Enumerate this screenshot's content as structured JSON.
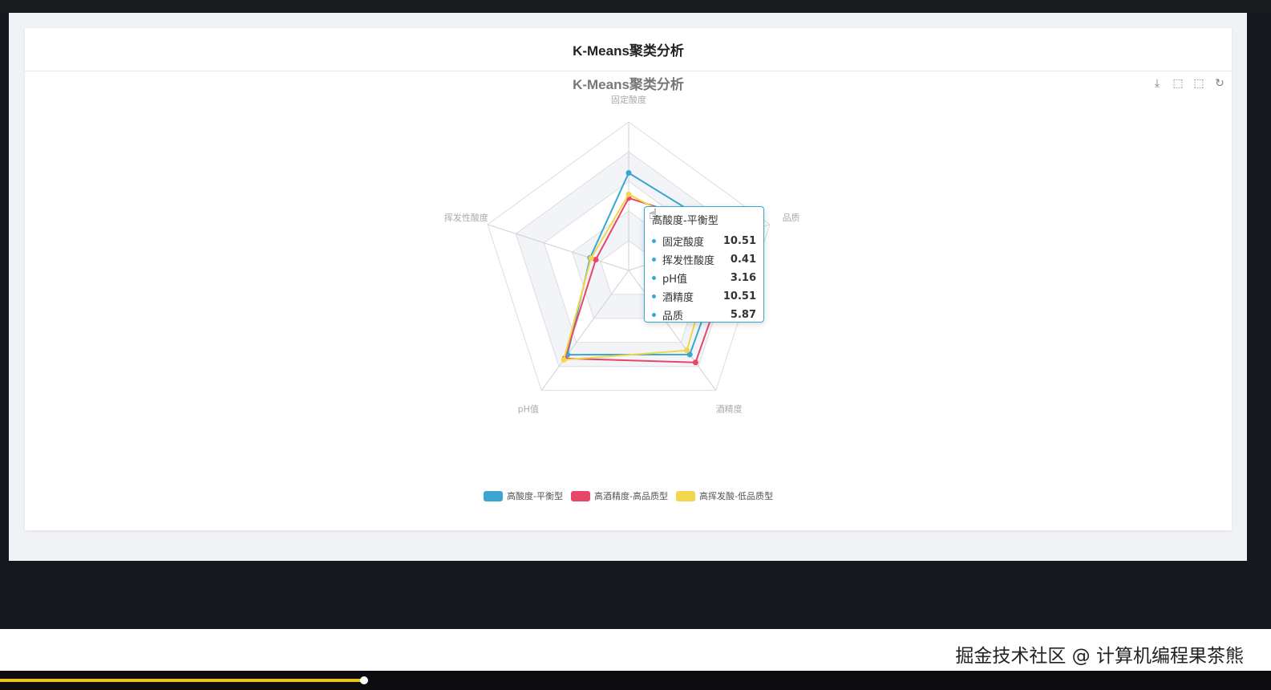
{
  "card": {
    "header_title": "K-Means聚类分析"
  },
  "chart_data": {
    "type": "radar",
    "title": "K-Means聚类分析",
    "indicators": [
      {
        "name": "固定酸度",
        "max": 16
      },
      {
        "name": "品质",
        "max": 8
      },
      {
        "name": "酒精度",
        "max": 15
      },
      {
        "name": "pH值",
        "max": 4.5
      },
      {
        "name": "挥发性酸度",
        "max": 1.5
      }
    ],
    "series": [
      {
        "name": "高酸度-平衡型",
        "color": "#3ba7d0",
        "values": [
          10.51,
          5.87,
          10.51,
          3.16,
          0.41
        ]
      },
      {
        "name": "高酒精度-高品质型",
        "color": "#e8456a",
        "values": [
          7.8,
          6.35,
          11.5,
          3.3,
          0.35
        ]
      },
      {
        "name": "高挥发酸-低品质型",
        "color": "#f2d64b",
        "values": [
          8.2,
          5.1,
          10.0,
          3.35,
          0.4
        ]
      }
    ],
    "split_number": 5,
    "legend_position": "bottom"
  },
  "tooltip": {
    "title": "高酸度-平衡型",
    "rows": [
      {
        "label": "固定酸度",
        "value": "10.51"
      },
      {
        "label": "挥发性酸度",
        "value": "0.41"
      },
      {
        "label": "pH值",
        "value": "3.16"
      },
      {
        "label": "酒精度",
        "value": "10.51"
      },
      {
        "label": "品质",
        "value": "5.87"
      }
    ],
    "color": "#3ba7d0"
  },
  "toolbox": [
    {
      "icon": "download-icon",
      "glyph": "⤓"
    },
    {
      "icon": "data-zoom-icon",
      "glyph": "⬚"
    },
    {
      "icon": "zoom-reset-icon",
      "glyph": "⬚"
    },
    {
      "icon": "restore-icon",
      "glyph": "↻"
    }
  ],
  "watermark": "掘金技术社区 @ 计算机编程果茶熊"
}
